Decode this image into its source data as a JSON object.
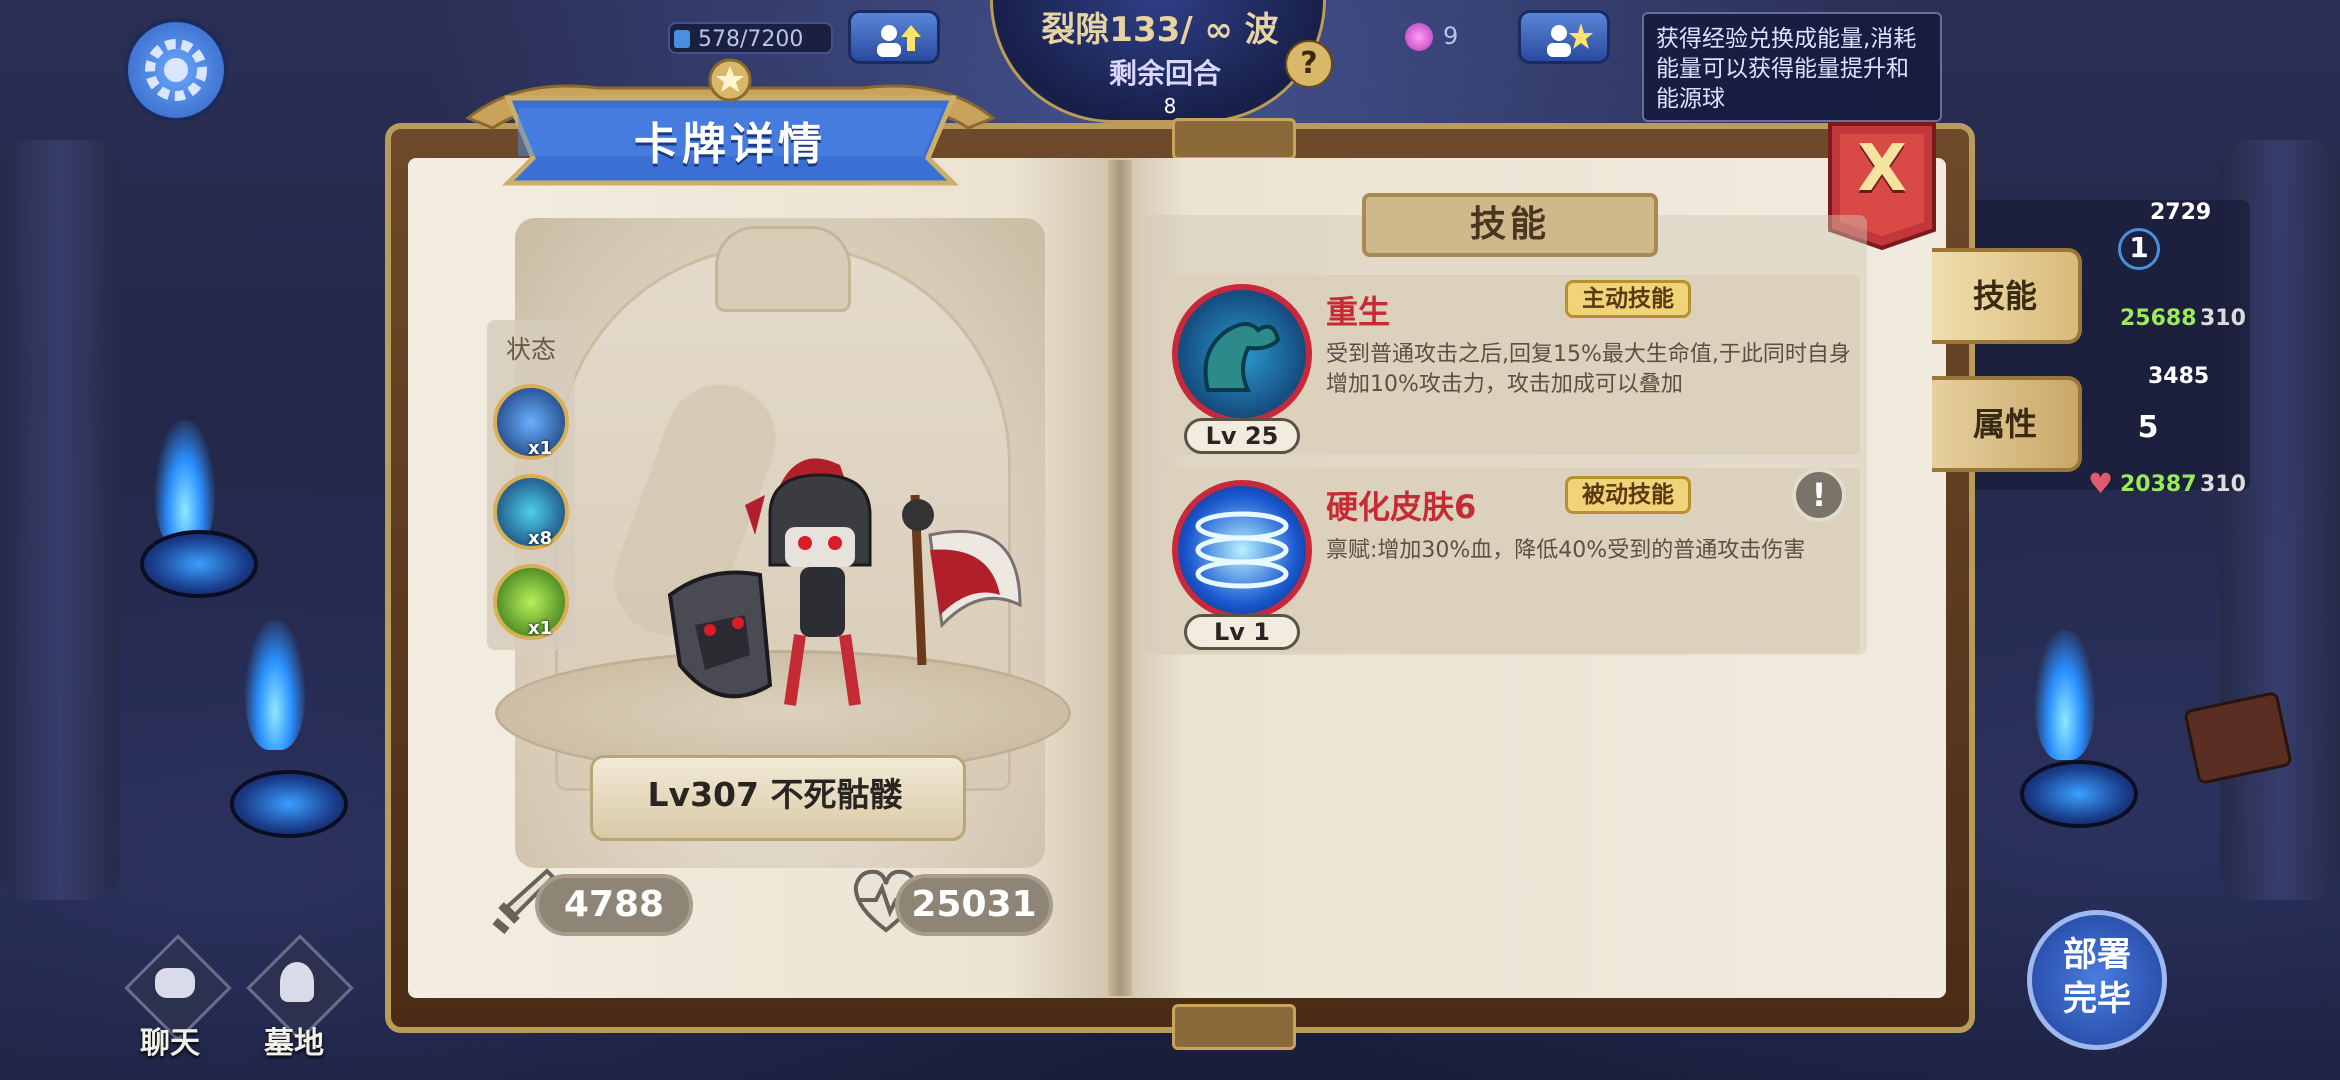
{
  "top_bar": {
    "exp": "578/7200",
    "wave_title": "裂隙133/ ∞ 波",
    "remaining_label": "剩余回合",
    "remaining_value": "8",
    "help_label": "?",
    "energy_count": "9",
    "tip_text": "获得经验兑换成能量,消耗能量可以获得能量提升和能源球"
  },
  "roster": {
    "unit1": {
      "atk": "2729",
      "level": "1",
      "hp": "25688",
      "extra": "310"
    },
    "unit2": {
      "atk": "3485",
      "level": "5",
      "hp": "20387",
      "extra": "310"
    }
  },
  "bottom_left": {
    "chat_label": "聊天",
    "graveyard_label": "墓地"
  },
  "deploy_button": {
    "line1": "部署",
    "line2": "完毕"
  },
  "dialog": {
    "title": "卡牌详情",
    "close_label": "X",
    "card": {
      "status_label": "状态",
      "statuses": [
        {
          "icon": "shadow-figure-icon",
          "count": "x1"
        },
        {
          "icon": "muscle-arm-icon",
          "count": "x8"
        },
        {
          "icon": "green-swords-icon",
          "count": "x1"
        }
      ],
      "name": "Lv307 不死骷髅",
      "attack": "4788",
      "health": "25031"
    },
    "skills_header": "技能",
    "skills": [
      {
        "name": "重生",
        "tag": "主动技能",
        "level": "Lv 25",
        "desc": "受到普通攻击之后,回复15%最大生命值,于此同时自身增加10%攻击力，攻击加成可以叠加",
        "icon": "muscle-arm-icon"
      },
      {
        "name": "硬化皮肤6",
        "tag": "被动技能",
        "level": "Lv 1",
        "desc": "禀赋:增加30%血，降低40%受到的普通攻击伤害",
        "icon": "blue-rings-icon"
      }
    ],
    "info_label": "!",
    "tabs": [
      "技能",
      "属性"
    ]
  }
}
